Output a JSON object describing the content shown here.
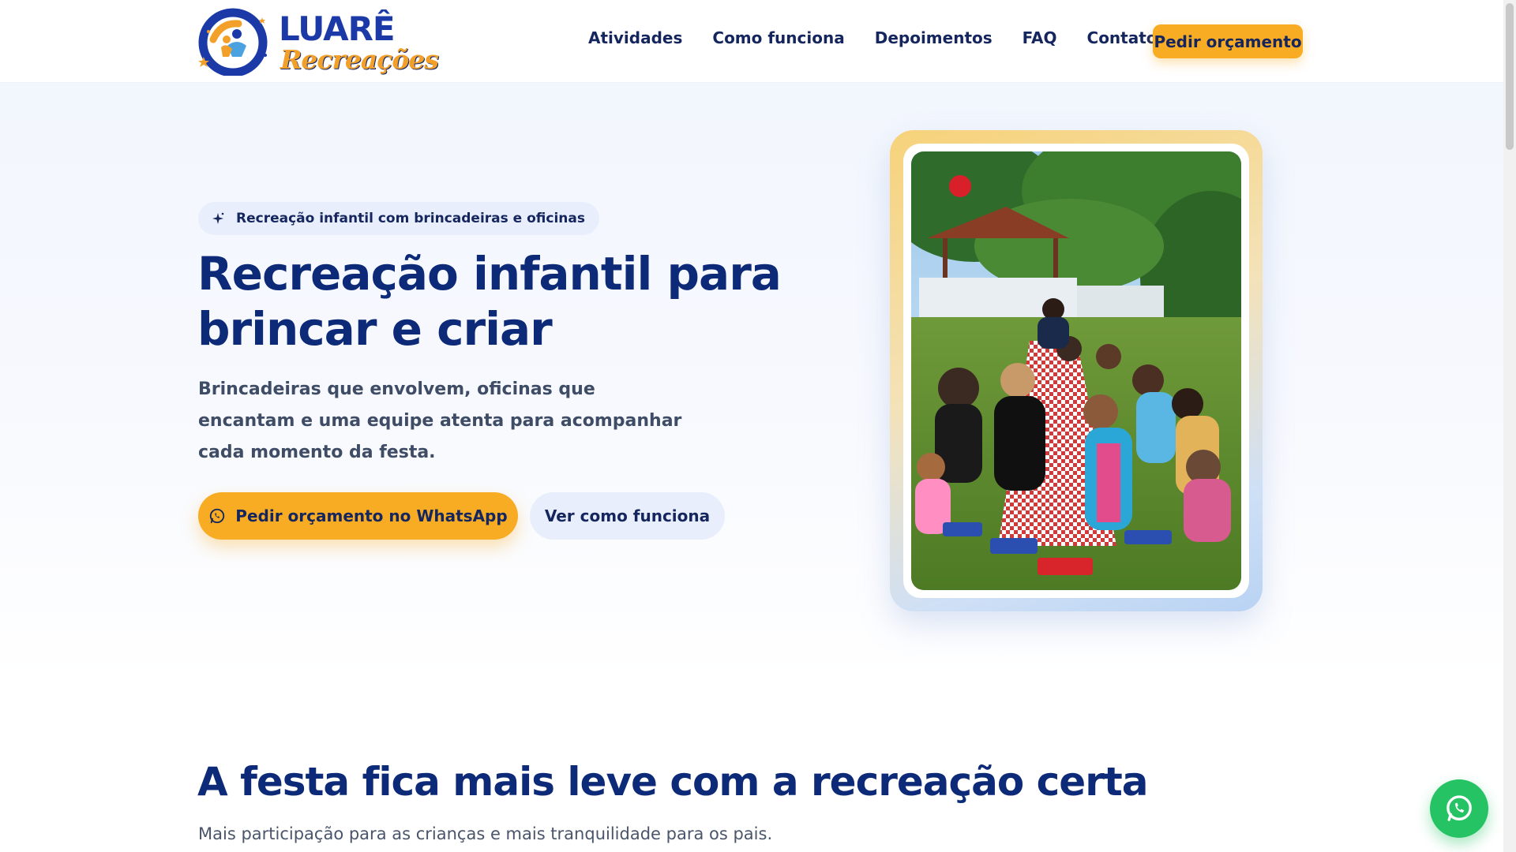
{
  "brand": {
    "name_top": "LUARÊ",
    "name_bottom": "Recreações"
  },
  "nav": {
    "items": [
      "Atividades",
      "Como funciona",
      "Depoimentos",
      "FAQ",
      "Contato"
    ],
    "cta_label": "Pedir orçamento"
  },
  "hero": {
    "badge": "Recreação infantil com brincadeiras e oficinas",
    "title": "Recreação infantil para brincar e criar",
    "subtitle": "Brincadeiras que envolvem, oficinas que encantam e uma equipe atenta para acompanhar cada momento da festa.",
    "primary_button": "Pedir orçamento no WhatsApp",
    "secondary_button": "Ver como funciona",
    "photo_icon": "party-photo"
  },
  "section": {
    "title": "A festa fica mais leve com a recreação certa",
    "subtitle": "Mais participação para as crianças e mais tranquilidade para os pais."
  },
  "floating": {
    "icon": "whatsapp-icon"
  },
  "colors": {
    "primary_blue": "#0c2a78",
    "accent_orange": "#f8ac23",
    "whatsapp_green": "#25c363"
  }
}
